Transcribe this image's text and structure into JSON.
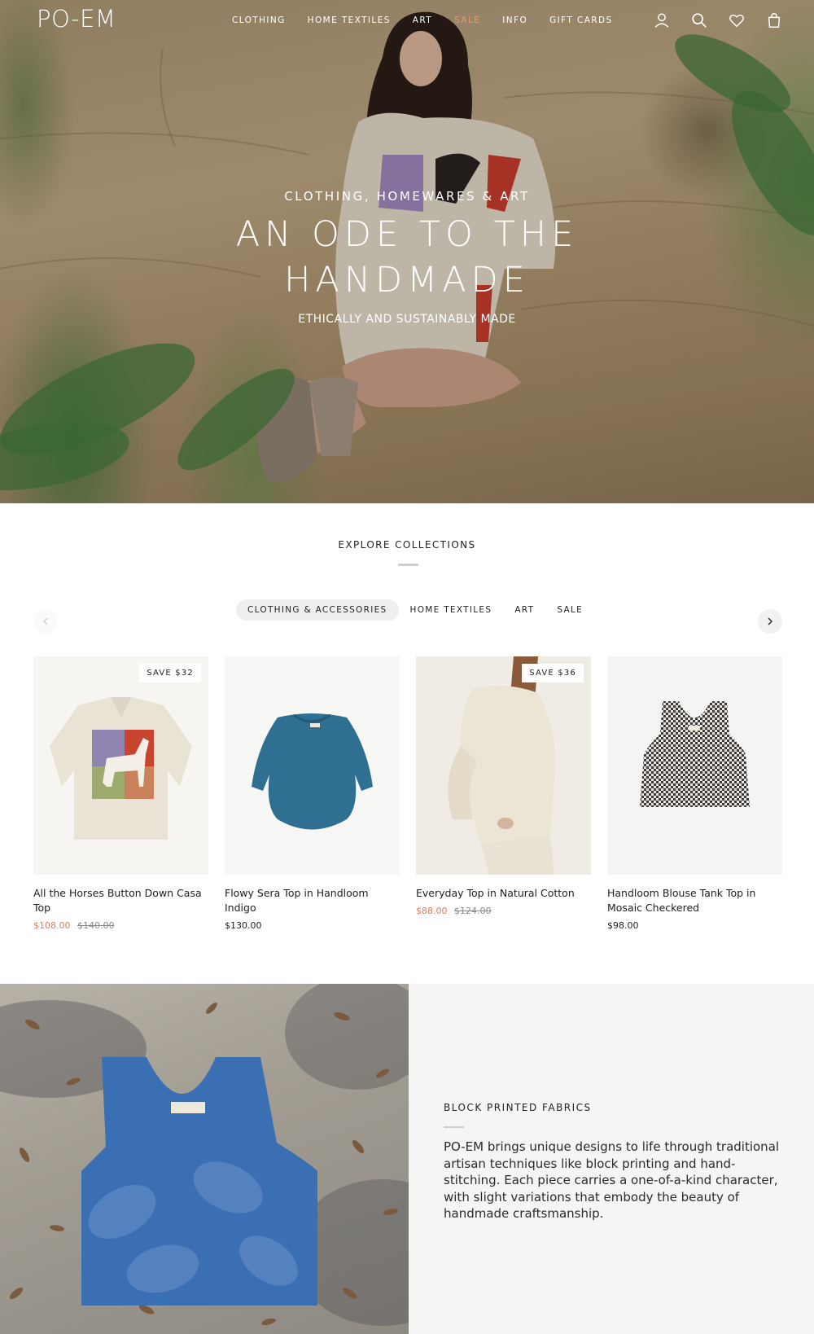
{
  "header": {
    "logo": "PO-EM",
    "nav": [
      {
        "label": "CLOTHING"
      },
      {
        "label": "HOME TEXTILES"
      },
      {
        "label": "ART"
      },
      {
        "label": "SALE",
        "accent": "#e7957a"
      },
      {
        "label": "INFO"
      },
      {
        "label": "GIFT CARDS"
      }
    ],
    "icons": [
      "account-icon",
      "search-icon",
      "heart-icon",
      "cart-icon"
    ]
  },
  "hero": {
    "eyebrow": "CLOTHING, HOMEWARES & ART",
    "title_line1": "AN ODE TO THE",
    "title_line2": "HANDMADE",
    "subtitle": "ETHICALLY AND SUSTAINABLY MADE"
  },
  "collections": {
    "title": "EXPLORE COLLECTIONS",
    "tabs": [
      {
        "label": "CLOTHING & ACCESSORIES",
        "active": true
      },
      {
        "label": "HOME TEXTILES",
        "active": false
      },
      {
        "label": "ART",
        "active": false
      },
      {
        "label": "SALE",
        "active": false
      }
    ],
    "products": [
      {
        "name": "All the Horses Button Down Casa Top",
        "badge": "SAVE $32",
        "price": "$108.00",
        "compare_price": "$140.00"
      },
      {
        "name": "Flowy Sera Top in Handloom Indigo",
        "badge": "",
        "price": "$130.00",
        "compare_price": ""
      },
      {
        "name": "Everyday Top in Natural Cotton",
        "badge": "SAVE $36",
        "price": "$88.00",
        "compare_price": "$124.00"
      },
      {
        "name": "Handloom Blouse Tank Top in Mosaic Checkered",
        "badge": "",
        "price": "$98.00",
        "compare_price": ""
      }
    ]
  },
  "feature": {
    "eyebrow": "BLOCK PRINTED FABRICS",
    "body": "PO-EM brings unique designs to life through traditional artisan techniques like block printing and hand-stitching. Each piece carries a one-of-a-kind character, with slight variations that embody the beauty of handmade craftsmanship.",
    "tag_text": "PO-EM"
  },
  "colors": {
    "sale_price": "#d77e5f",
    "nav_sale": "#e7957a",
    "tab_active_bg": "#efefef",
    "feature_panel_bg": "#f5f5f4"
  }
}
